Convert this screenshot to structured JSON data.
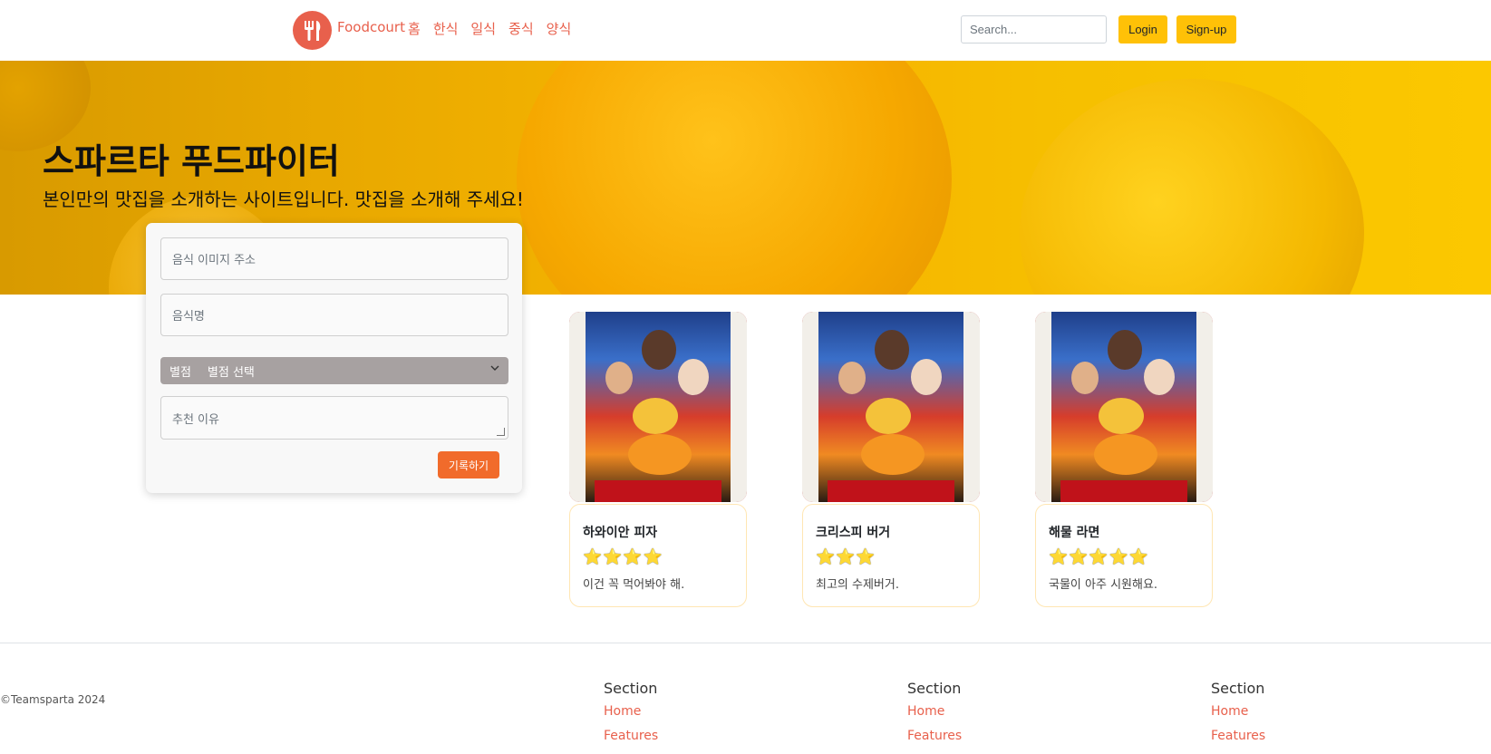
{
  "header": {
    "brand": "Foodcourt",
    "nav": [
      "홈",
      "한식",
      "일식",
      "중식",
      "양식"
    ],
    "search_placeholder": "Search...",
    "login_label": "Login",
    "signup_label": "Sign-up",
    "accent_color": "#e8604c",
    "button_color": "#ffc107"
  },
  "hero": {
    "title": "스파르타 푸드파이터",
    "subtitle": "본인만의 맛집을 소개하는 사이트입니다. 맛집을 소개해 주세요!"
  },
  "form": {
    "image_url_placeholder": "음식 이미지 주소",
    "food_name_placeholder": "음식명",
    "rating_label": "별점",
    "rating_selected": "별점 선택",
    "reason_placeholder": "추천 이유",
    "submit_label": "기록하기",
    "submit_color": "#f16b2b"
  },
  "cards": [
    {
      "title": "하와이안 피자",
      "stars": "⭐⭐⭐⭐",
      "rating": 4,
      "text": "이건 꼭 먹어봐야 해."
    },
    {
      "title": "크리스피 버거",
      "stars": "⭐⭐⭐",
      "rating": 3,
      "text": "최고의 수제버거."
    },
    {
      "title": "해물 라면",
      "stars": "⭐⭐⭐⭐⭐",
      "rating": 5,
      "text": "국물이 아주 시원해요."
    }
  ],
  "footer": {
    "copyright": "©Teamsparta 2024",
    "sections": [
      {
        "heading": "Section",
        "links": [
          "Home",
          "Features"
        ]
      },
      {
        "heading": "Section",
        "links": [
          "Home",
          "Features"
        ]
      },
      {
        "heading": "Section",
        "links": [
          "Home",
          "Features"
        ]
      }
    ]
  }
}
